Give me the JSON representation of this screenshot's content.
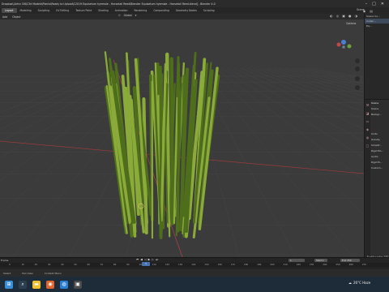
{
  "window": {
    "title": "Dropbox\\(Arhiv ON\\C3d Models\\Plants\\Ready to Upload\\C2019 Equisetum hyemale - Horsetail Reed\\Blender Equisetum hyemale - Horsetail Reed.blend] - Blender 4.0"
  },
  "workspaces": [
    "Layout",
    "Modeling",
    "Sculpting",
    "UV Editing",
    "Texture Paint",
    "Shading",
    "Animation",
    "Rendering",
    "Compositing",
    "Geometry Nodes",
    "Scripting"
  ],
  "scene_label": "Scene",
  "viewport_header": {
    "menus": [
      "Add",
      "Object"
    ],
    "orientation": "Global",
    "options_label": "Options"
  },
  "outliner": {
    "rows": [
      "Scene Co...",
      "Collec...",
      "Eq..."
    ]
  },
  "properties": {
    "rows": [
      "Scene",
      "Scene",
      "Backgr...",
      "Units",
      "Gravity",
      "Simplif...",
      "Rigid Bo...",
      "Audio",
      "Rigid B...",
      "Custom..."
    ]
  },
  "activate": {
    "title": "Activate W",
    "sub": "Go to Settin"
  },
  "timeline": {
    "label": "Frame",
    "start_label": "Start",
    "start_value": "1",
    "end_label": "End",
    "end_value": "250",
    "current_frame": "1",
    "ticks": [
      "0",
      "10",
      "20",
      "30",
      "40",
      "50",
      "60",
      "70",
      "80",
      "90",
      "100",
      "110",
      "120",
      "130",
      "140",
      "150",
      "160",
      "170",
      "180",
      "190",
      "200",
      "210",
      "220",
      "230",
      "240",
      "250",
      "260",
      "270"
    ]
  },
  "statusbar": {
    "items": [
      "Select",
      "Pan View",
      "Context Menu"
    ]
  },
  "taskbar": {
    "weather": "26°C Haze"
  },
  "colors": {
    "grass_dark": "#4f6e1c",
    "grass_light": "#8aaa3a",
    "viewport_bg": "#3b3b3b",
    "accent": "#4772b3"
  }
}
